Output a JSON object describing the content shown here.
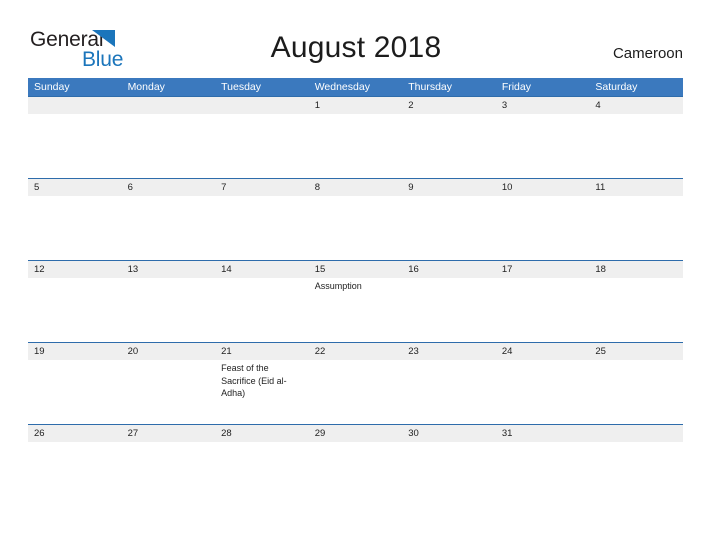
{
  "brand": {
    "word_one": "General",
    "word_two": "Blue",
    "flag_icon": "flag-triangle-icon",
    "color_dark": "#231f20",
    "color_blue": "#1b75bb"
  },
  "header": {
    "title": "August 2018",
    "region": "Cameroon"
  },
  "theme": {
    "header_blue": "#3b79be",
    "row_border_blue": "#2e6cab",
    "date_band_gray": "#efefef",
    "text_dark": "#222222",
    "white": "#ffffff"
  },
  "calendar": {
    "month": "August",
    "year": "2018",
    "weekday_headers": [
      "Sunday",
      "Monday",
      "Tuesday",
      "Wednesday",
      "Thursday",
      "Friday",
      "Saturday"
    ],
    "weeks": [
      {
        "days": [
          {
            "date": "",
            "event": ""
          },
          {
            "date": "",
            "event": ""
          },
          {
            "date": "",
            "event": ""
          },
          {
            "date": "1",
            "event": ""
          },
          {
            "date": "2",
            "event": ""
          },
          {
            "date": "3",
            "event": ""
          },
          {
            "date": "4",
            "event": ""
          }
        ]
      },
      {
        "days": [
          {
            "date": "5",
            "event": ""
          },
          {
            "date": "6",
            "event": ""
          },
          {
            "date": "7",
            "event": ""
          },
          {
            "date": "8",
            "event": ""
          },
          {
            "date": "9",
            "event": ""
          },
          {
            "date": "10",
            "event": ""
          },
          {
            "date": "11",
            "event": ""
          }
        ]
      },
      {
        "days": [
          {
            "date": "12",
            "event": ""
          },
          {
            "date": "13",
            "event": ""
          },
          {
            "date": "14",
            "event": ""
          },
          {
            "date": "15",
            "event": "Assumption"
          },
          {
            "date": "16",
            "event": ""
          },
          {
            "date": "17",
            "event": ""
          },
          {
            "date": "18",
            "event": ""
          }
        ]
      },
      {
        "days": [
          {
            "date": "19",
            "event": ""
          },
          {
            "date": "20",
            "event": ""
          },
          {
            "date": "21",
            "event": "Feast of the Sacrifice (Eid al-Adha)"
          },
          {
            "date": "22",
            "event": ""
          },
          {
            "date": "23",
            "event": ""
          },
          {
            "date": "24",
            "event": ""
          },
          {
            "date": "25",
            "event": ""
          }
        ]
      },
      {
        "days": [
          {
            "date": "26",
            "event": ""
          },
          {
            "date": "27",
            "event": ""
          },
          {
            "date": "28",
            "event": ""
          },
          {
            "date": "29",
            "event": ""
          },
          {
            "date": "30",
            "event": ""
          },
          {
            "date": "31",
            "event": ""
          },
          {
            "date": "",
            "event": ""
          }
        ]
      }
    ]
  }
}
